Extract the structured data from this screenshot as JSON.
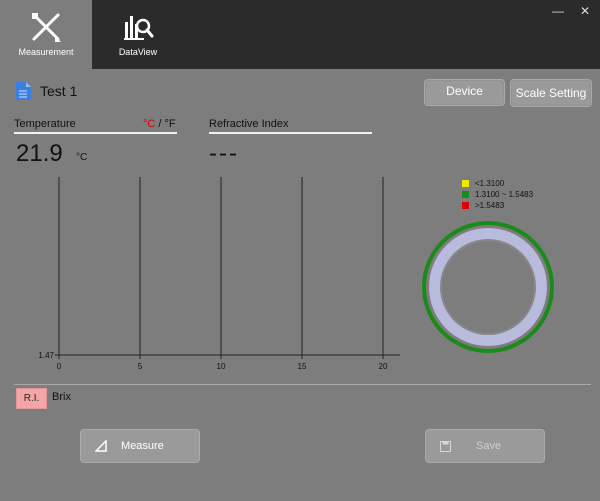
{
  "tabs": [
    {
      "label": "Measurement",
      "icon": "pencil-ruler-icon",
      "active": true
    },
    {
      "label": "DataView",
      "icon": "chart-magnifier-icon",
      "active": false
    }
  ],
  "window": {
    "minimize": "—",
    "close": "✕"
  },
  "title": "Test 1",
  "buttons": {
    "device": "Device",
    "scale": "Scale Setting",
    "measure": "Measure",
    "save": "Save"
  },
  "temperature": {
    "label": "Temperature",
    "unit_c": "°C",
    "sep": " / ",
    "unit_f": "°F",
    "value": "21.9",
    "unit": "°C"
  },
  "refractive": {
    "label": "Refractive Index",
    "value": "---"
  },
  "legend": [
    {
      "label": "<1.3100",
      "color": "#f5e600"
    },
    {
      "label": "1.3100 ~ 1.5483",
      "color": "#1b8a1b"
    },
    {
      "label": ">1.5483",
      "color": "#e00000"
    }
  ],
  "modes": {
    "ri": "R.I.",
    "brix": "Brix"
  },
  "chart_data": {
    "type": "line",
    "x_ticks": [
      "0",
      "5",
      "10",
      "15",
      "20"
    ],
    "x_values": [
      0,
      5,
      10,
      15,
      20
    ],
    "y_tick": "1.47",
    "xlim": [
      0,
      20
    ],
    "grid": true,
    "series": []
  }
}
